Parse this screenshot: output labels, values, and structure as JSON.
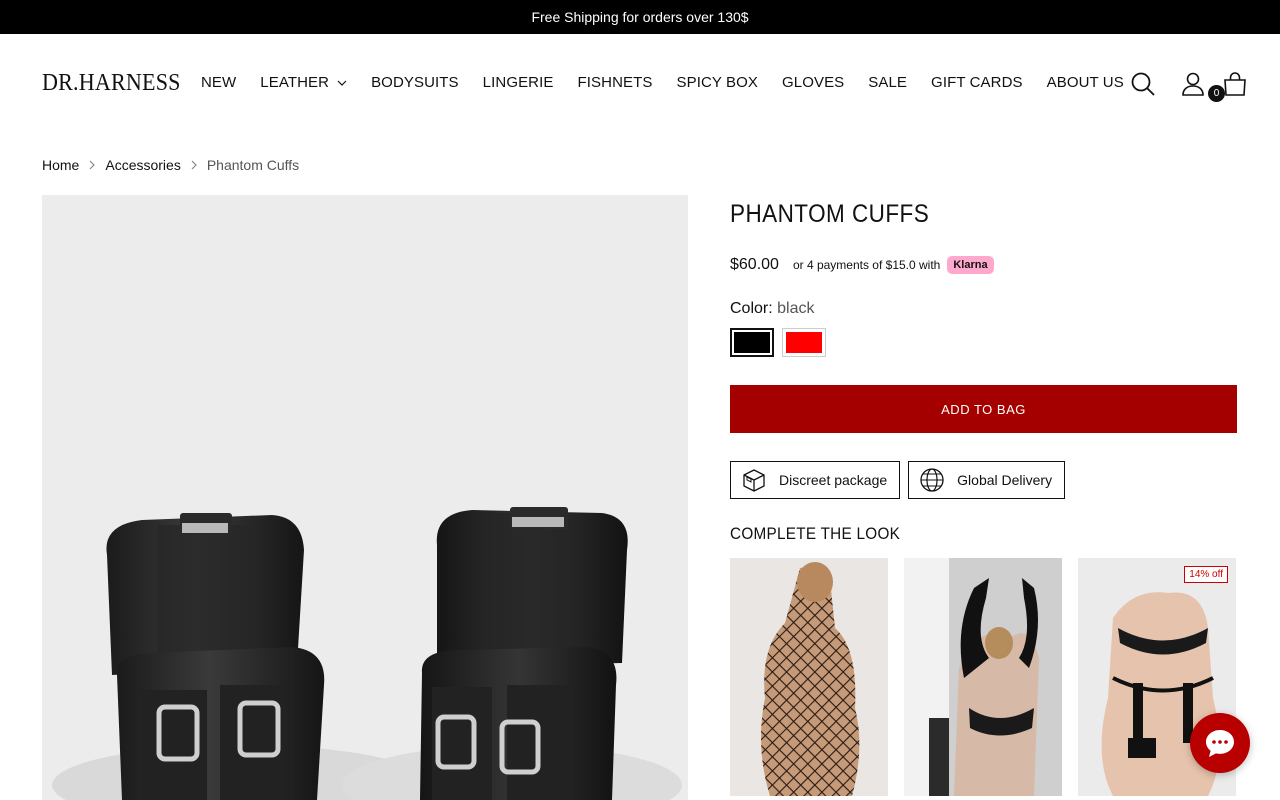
{
  "announcement": "Free Shipping for orders over 130$",
  "brand": "DR.HARNESS",
  "nav": {
    "items": [
      "NEW",
      "LEATHER",
      "BODYSUITS",
      "LINGERIE",
      "FISHNETS",
      "SPICY BOX",
      "GLOVES",
      "SALE",
      "GIFT CARDS",
      "ABOUT US"
    ]
  },
  "header_icons": [
    "search-icon",
    "account-icon",
    "cart-icon"
  ],
  "cart_count": "0",
  "breadcrumb": {
    "home": "Home",
    "category": "Accessories",
    "current": "Phantom Cuffs"
  },
  "product": {
    "title": "PHANTOM CUFFS",
    "price": "$60.00",
    "installment": "or 4 payments of $15.0 with",
    "klarna": "Klarna",
    "color_label": "Color:",
    "color_value": "black",
    "swatches": [
      {
        "name": "black",
        "color": "#000000"
      },
      {
        "name": "red",
        "color": "#ff0000"
      }
    ],
    "add_to_bag": "ADD TO BAG",
    "perks": [
      "Discreet package",
      "Global Delivery"
    ]
  },
  "complete_the_look": {
    "heading": "COMPLETE THE LOOK",
    "badge": "14% off"
  },
  "colors": {
    "accent": "#a50000",
    "announce_bg": "#000000",
    "klarna_pink": "#ffa8cd",
    "chat": "#b80000"
  }
}
